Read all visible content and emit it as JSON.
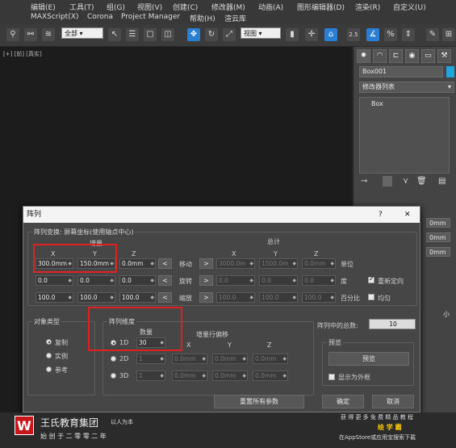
{
  "menubar": {
    "row1": [
      "编辑(E)",
      "工具(T)",
      "组(G)",
      "视图(V)",
      "创建(C)",
      "修改器(M)",
      "动画(A)",
      "图形编辑器(D)",
      "渲染(R)",
      "自定义(U)"
    ],
    "row2": [
      "MAXScript(X)",
      "Corona",
      "Project Manager",
      "帮助(H)",
      "渲云库"
    ]
  },
  "toolbar": {
    "filter_value": "全部",
    "refcoord_value": "视图",
    "snap_label": "2.5"
  },
  "viewport": {
    "label": "[+] [前] [真实]"
  },
  "command_panel": {
    "object_name": "Box001",
    "modifier_list": "修改器列表",
    "stack_item": "Box",
    "side_values": [
      "0mm",
      "0mm",
      "0mm"
    ],
    "side_tail": "小"
  },
  "dialog": {
    "title": "阵列",
    "help": "?",
    "close": "✕",
    "transform_group": "阵列变换: 屏幕坐标(使用轴点中心)",
    "increment_label": "增量",
    "total_label": "总计",
    "axis": [
      "X",
      "Y",
      "Z"
    ],
    "rows": [
      {
        "label": "移动",
        "inc": [
          "300.0mm",
          "150.0mm",
          "0.0mm"
        ],
        "total": [
          "3000.0m",
          "1500.0m",
          "0.0mm"
        ],
        "unit": "单位"
      },
      {
        "label": "旋转",
        "inc": [
          "0.0",
          "0.0",
          "0.0"
        ],
        "total": [
          "0.0",
          "0.0",
          "0.0"
        ],
        "unit": "度"
      },
      {
        "label": "缩放",
        "inc": [
          "100.0",
          "100.0",
          "100.0"
        ],
        "total": [
          "100.0",
          "100.0",
          "100.0"
        ],
        "unit": "百分比"
      }
    ],
    "reorient": "重新定向",
    "uniform": "均匀",
    "object_type": {
      "title": "对象类型",
      "options": [
        "复制",
        "实例",
        "参考"
      ]
    },
    "dimensions": {
      "title": "阵列维度",
      "count_label": "数量",
      "offset_label": "增量行偏移",
      "options": [
        "1D",
        "2D",
        "3D"
      ],
      "counts": [
        "30",
        "1",
        "1"
      ],
      "offsets2d": [
        "0.0mm",
        "0.0mm",
        "0.0mm"
      ],
      "offsets3d": [
        "0.0mm",
        "0.0mm",
        "0.0mm"
      ]
    },
    "total_count_label": "阵列中的总数:",
    "total_count": "10",
    "preview": {
      "title": "预览",
      "button": "预览",
      "display_as_box": "显示为外框"
    },
    "reset_button": "重置所有参数",
    "ok_button": "确定",
    "cancel_button": "取消"
  },
  "footer": {
    "logo_text": "王氏教育集团",
    "logo_sub": "以人为本",
    "tagline": "始 创 于 二 零 零 二 年",
    "promo1": "获 得 更 多 免 费 精 品 教 程",
    "promo2": "绘 学 霸",
    "promo3": "在AppStore或应用宝搜索下载"
  }
}
